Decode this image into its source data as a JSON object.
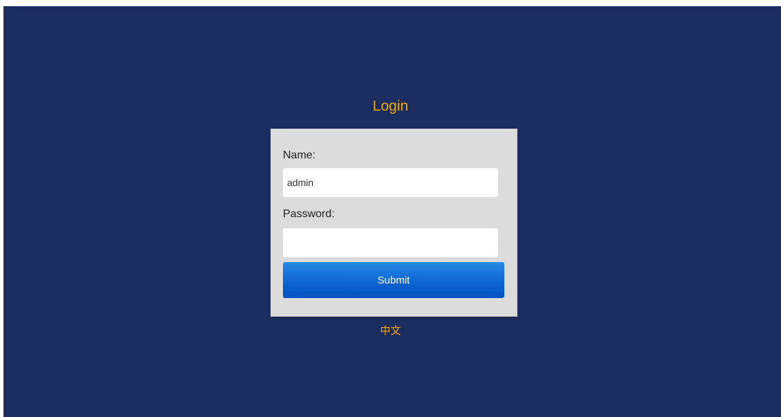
{
  "page": {
    "title": "Login",
    "language_link": "中文"
  },
  "form": {
    "name_label": "Name:",
    "name_value": "admin",
    "password_label": "Password:",
    "password_value": "",
    "submit_label": "Submit"
  },
  "colors": {
    "background": "#1b2d5e",
    "accent": "#f5a800",
    "card": "#dcdcdc",
    "button": "#0d66d2"
  }
}
